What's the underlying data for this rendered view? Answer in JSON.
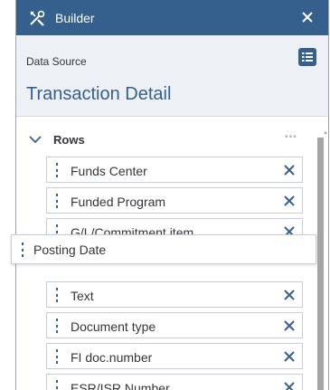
{
  "window": {
    "title": "Builder",
    "title_icon": "tools-icon",
    "close_icon": "close-icon",
    "colors": {
      "titlebar": "#355f8d",
      "header_bg": "#edf1f5",
      "accent": "#355f8d"
    }
  },
  "data_source": {
    "label": "Data Source",
    "button_icon": "data-source-list-icon",
    "name": "Transaction Detail"
  },
  "rows": {
    "label": "Rows",
    "more_label": "°°°",
    "items": [
      {
        "label": "Funds Center"
      },
      {
        "label": "Funded Program"
      },
      {
        "label": "G/L/Commitment item"
      },
      {
        "label": "Text"
      },
      {
        "label": "Document type"
      },
      {
        "label": "FI doc.number"
      },
      {
        "label": "ESR/ISR Number"
      }
    ],
    "dragging_item": {
      "label": "Posting Date"
    }
  }
}
